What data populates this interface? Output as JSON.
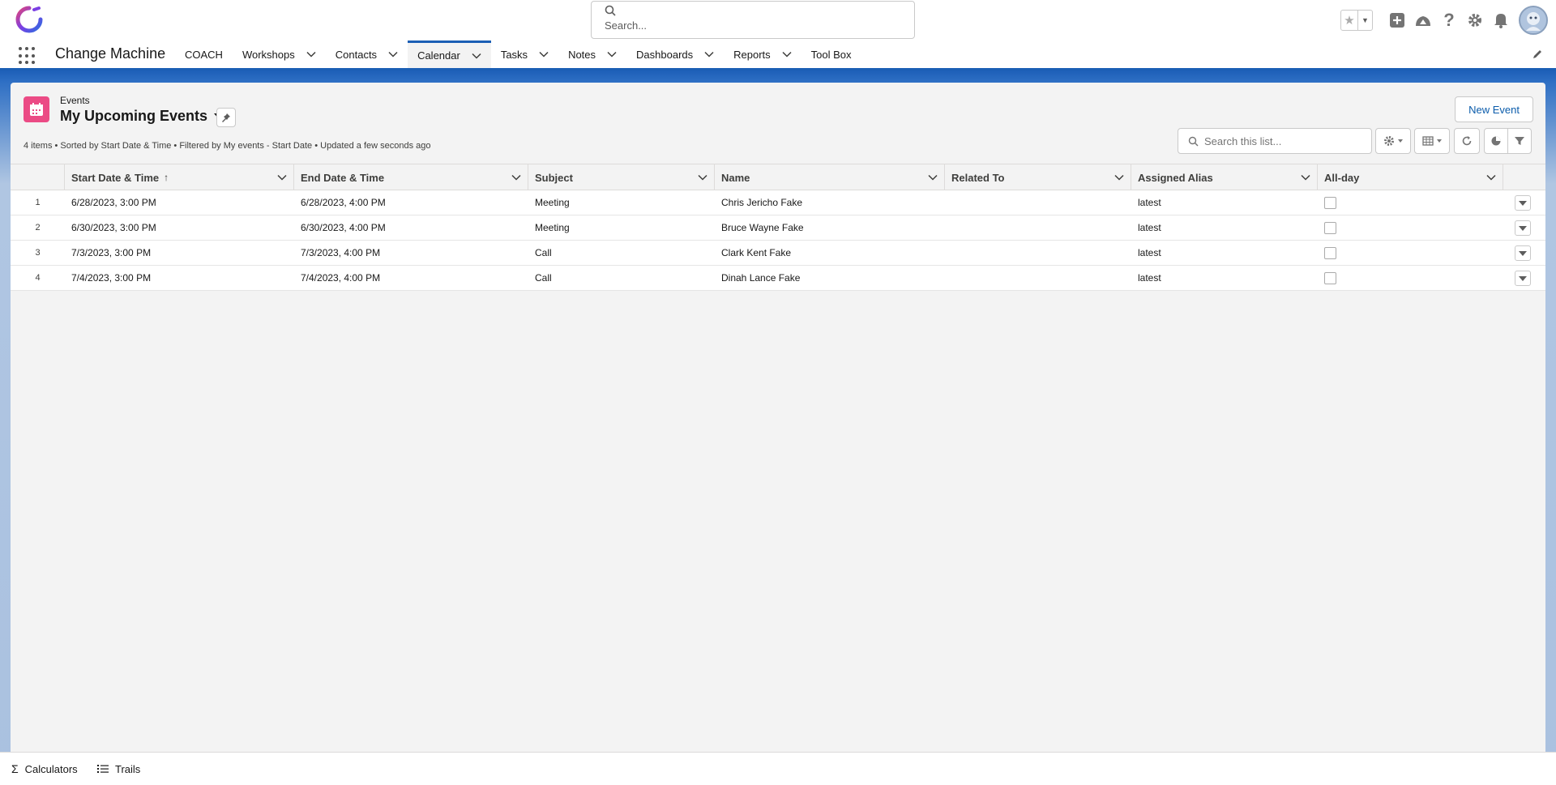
{
  "global_header": {
    "search_placeholder": "Search...",
    "icons": [
      "favorites-star-icon",
      "favorites-dropdown-icon",
      "global-add-icon",
      "trailhead-icon",
      "help-icon",
      "setup-gear-icon",
      "notifications-bell-icon",
      "user-avatar"
    ]
  },
  "app_nav": {
    "app_name": "Change Machine",
    "items": [
      {
        "label": "COACH",
        "has_menu": false,
        "active": false
      },
      {
        "label": "Workshops",
        "has_menu": true,
        "active": false
      },
      {
        "label": "Contacts",
        "has_menu": true,
        "active": false
      },
      {
        "label": "Calendar",
        "has_menu": true,
        "active": true
      },
      {
        "label": "Tasks",
        "has_menu": true,
        "active": false
      },
      {
        "label": "Notes",
        "has_menu": true,
        "active": false
      },
      {
        "label": "Dashboards",
        "has_menu": true,
        "active": false
      },
      {
        "label": "Reports",
        "has_menu": true,
        "active": false
      },
      {
        "label": "Tool Box",
        "has_menu": false,
        "active": false
      }
    ]
  },
  "list_view": {
    "object_label": "Events",
    "title": "My Upcoming Events",
    "info": "4 items • Sorted by Start Date & Time • Filtered by My events - Start Date • Updated a few seconds ago",
    "new_button": "New Event",
    "search_placeholder": "Search this list...",
    "columns": [
      {
        "label": "Start Date & Time",
        "sorted": "asc"
      },
      {
        "label": "End Date & Time"
      },
      {
        "label": "Subject"
      },
      {
        "label": "Name"
      },
      {
        "label": "Related To"
      },
      {
        "label": "Assigned Alias"
      },
      {
        "label": "All-day"
      }
    ],
    "rows": [
      {
        "num": "1",
        "start": "6/28/2023, 3:00 PM",
        "end": "6/28/2023, 4:00 PM",
        "subject": "Meeting",
        "name": "Chris Jericho Fake",
        "related": "",
        "alias": "latest",
        "all_day": false
      },
      {
        "num": "2",
        "start": "6/30/2023, 3:00 PM",
        "end": "6/30/2023, 4:00 PM",
        "subject": "Meeting",
        "name": "Bruce Wayne Fake",
        "related": "",
        "alias": "latest",
        "all_day": false
      },
      {
        "num": "3",
        "start": "7/3/2023, 3:00 PM",
        "end": "7/3/2023, 4:00 PM",
        "subject": "Call",
        "name": "Clark Kent Fake",
        "related": "",
        "alias": "latest",
        "all_day": false
      },
      {
        "num": "4",
        "start": "7/4/2023, 3:00 PM",
        "end": "7/4/2023, 4:00 PM",
        "subject": "Call",
        "name": "Dinah Lance Fake",
        "related": "",
        "alias": "latest",
        "all_day": false
      }
    ]
  },
  "utility_bar": {
    "items": [
      {
        "label": "Calculators",
        "icon": "sigma-icon"
      },
      {
        "label": "Trails",
        "icon": "list-icon"
      }
    ]
  },
  "colors": {
    "brand_blue": "#1b5fb5",
    "events_icon_pink": "#eb4b85",
    "link_blue": "#0b5cab"
  }
}
